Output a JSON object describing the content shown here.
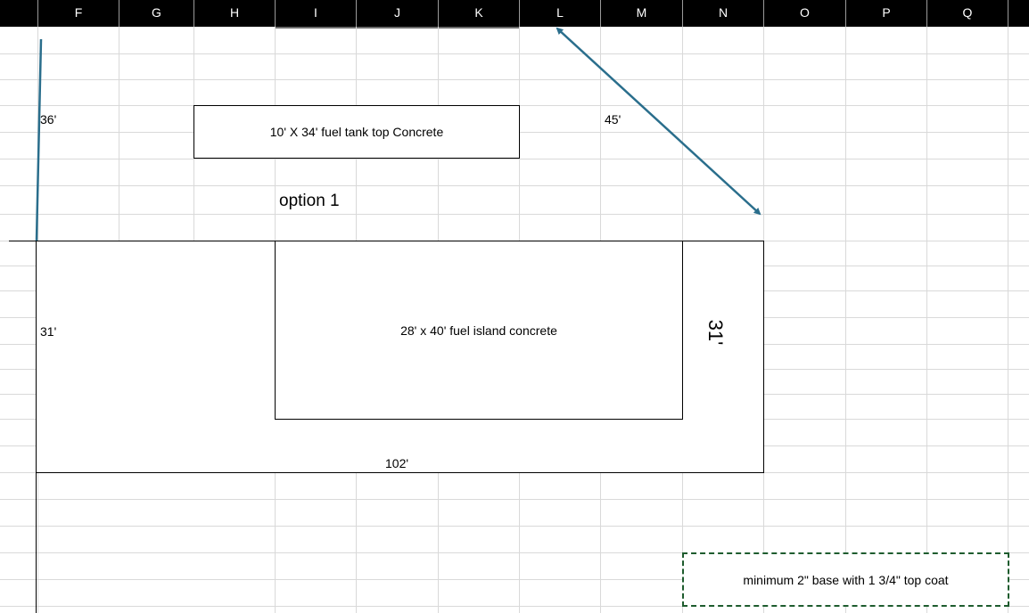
{
  "columns": [
    "F",
    "G",
    "H",
    "I",
    "J",
    "K",
    "L",
    "M",
    "N",
    "O",
    "P",
    "Q"
  ],
  "cells": {
    "dim_36": "36'",
    "dim_45": "45'",
    "dim_31_left": "31'",
    "dim_102": "102'",
    "option": "option 1"
  },
  "shapes": {
    "fuel_tank": "10' X 34' fuel tank top Concrete",
    "fuel_island": "28' x 40' fuel island  concrete",
    "rotated_dim": "31'",
    "note": "minimum 2\" base with 1 3/4\" top coat"
  },
  "colors": {
    "arrow": "#2a6e8c",
    "note_border": "#1e5c2e",
    "gridline": "#d9d9d9",
    "header_bg": "#000000"
  }
}
